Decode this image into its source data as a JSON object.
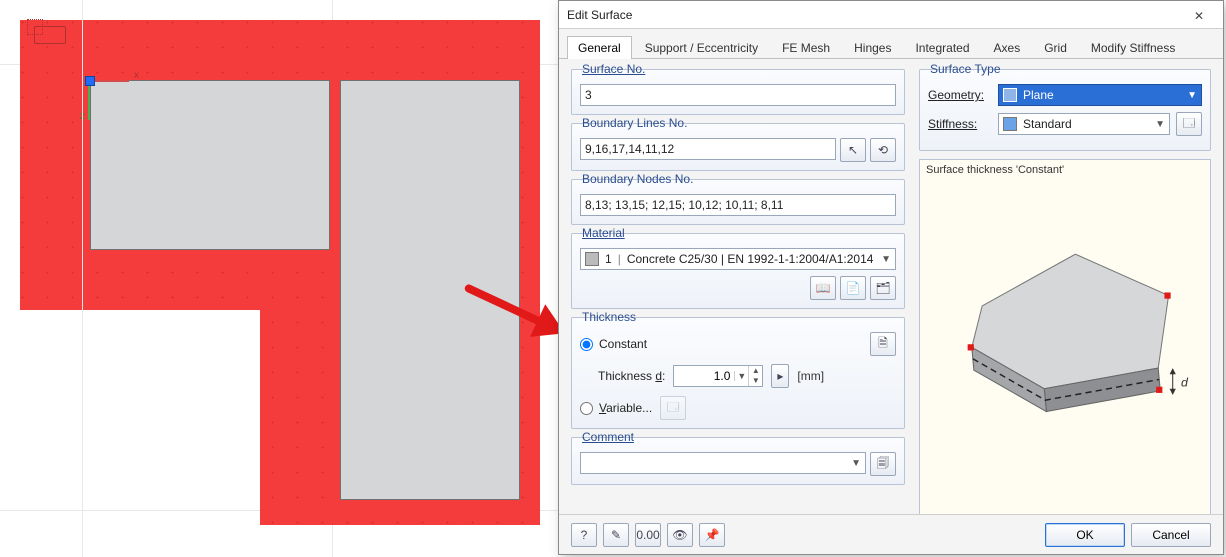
{
  "dialog": {
    "title": "Edit Surface",
    "close_glyph": "✕",
    "tabs": [
      {
        "label": "General",
        "active": true
      },
      {
        "label": "Support / Eccentricity"
      },
      {
        "label": "FE Mesh"
      },
      {
        "label": "Hinges"
      },
      {
        "label": "Integrated"
      },
      {
        "label": "Axes"
      },
      {
        "label": "Grid"
      },
      {
        "label": "Modify Stiffness"
      }
    ],
    "groups": {
      "surface_no": {
        "legend": "Surface No.",
        "value": "3"
      },
      "boundary_lines": {
        "legend": "Boundary Lines No.",
        "value": "9,16,17,14,11,12",
        "btn1_icon": "↖",
        "btn2_icon": "⟲"
      },
      "boundary_nodes": {
        "legend": "Boundary Nodes No.",
        "value": "8,13; 13,15; 12,15; 10,12; 10,11; 8,11"
      },
      "material": {
        "legend": "Material",
        "index": "1",
        "value": "Concrete C25/30 | EN 1992-1-1:2004/A1:2014",
        "btn1_icon": "📖",
        "btn2_icon": "📄",
        "btn3_icon": "🗂"
      },
      "thickness": {
        "legend": "Thickness",
        "constant_label": "Constant",
        "constant_checked": true,
        "d_label": "Thickness d:",
        "d_value": "1.0",
        "d_unit": "[mm]",
        "variable_label": "Variable...",
        "variable_checked": false,
        "corner_btn_icon": "🗎",
        "var_btn_icon": "🗔",
        "stepper_icon": "▸"
      },
      "comment": {
        "legend": "Comment",
        "value": "",
        "btn_icon": "🗐"
      }
    },
    "surface_type": {
      "legend": "Surface Type",
      "geometry_label": "Geometry:",
      "geometry_value": "Plane",
      "stiffness_label": "Stiffness:",
      "stiffness_value": "Standard",
      "side_btn_icon": "🗔"
    },
    "preview": {
      "caption": "Surface thickness 'Constant'",
      "d_label": "d"
    },
    "footer": {
      "help_icon": "?",
      "edit_icon": "✎",
      "units_icon": "0.00",
      "eye_icon": "👁",
      "pin_icon": "📌",
      "ok": "OK",
      "cancel": "Cancel"
    }
  },
  "viewport": {
    "axis_x": "x",
    "axis_z": "z"
  }
}
